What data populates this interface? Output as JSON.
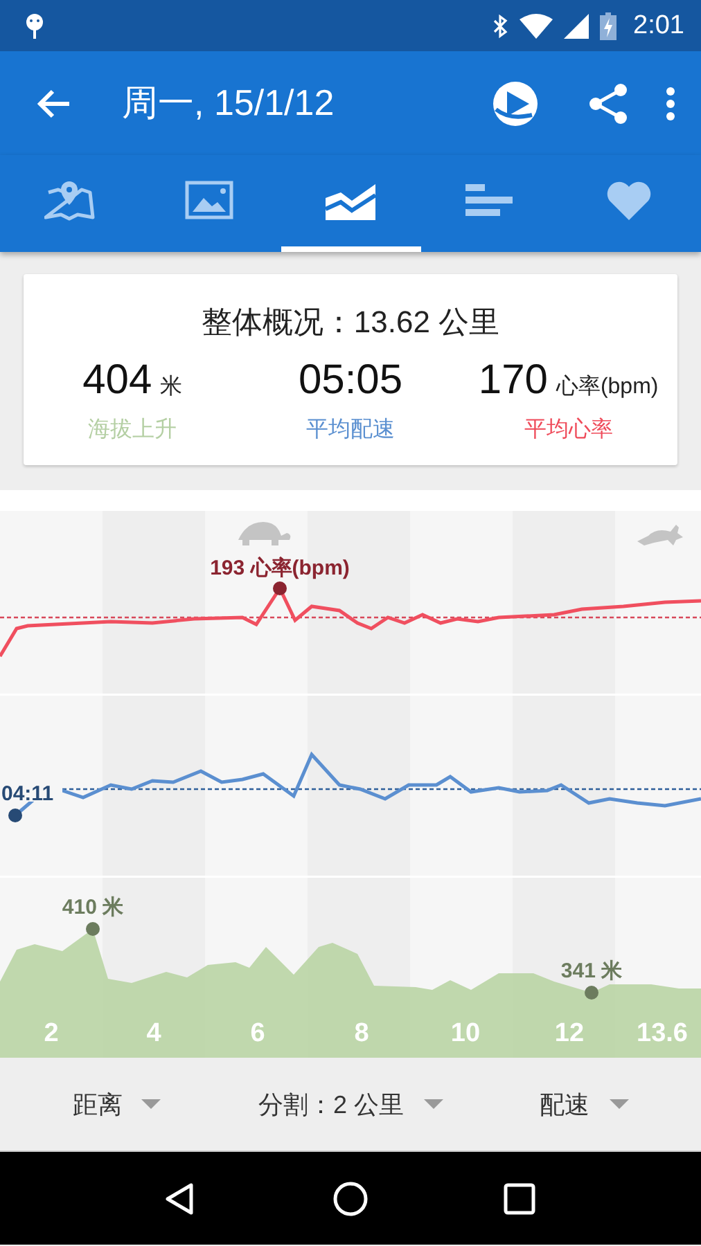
{
  "status_bar": {
    "time": "2:01"
  },
  "app_bar": {
    "title": "周一, 15/1/12"
  },
  "tabs": [
    {
      "kind": "map",
      "selected": false
    },
    {
      "kind": "photo",
      "selected": false
    },
    {
      "kind": "chart",
      "selected": true
    },
    {
      "kind": "bars",
      "selected": false
    },
    {
      "kind": "heart",
      "selected": false
    }
  ],
  "summary": {
    "title": "整体概况：13.62 公里",
    "stats": [
      {
        "value": "404",
        "unit": "米",
        "label": "海拔上升",
        "color": "#b4cfa3"
      },
      {
        "value": "05:05",
        "label": "平均配速",
        "color": "#5a8fd0"
      },
      {
        "value": "170",
        "unit": "心率(bpm)",
        "label": "平均心率",
        "color": "#ef4b5a"
      }
    ]
  },
  "chart": {
    "panels": [
      {
        "kind": "heart_rate",
        "annotations": [
          "193 心率(bpm)"
        ]
      },
      {
        "kind": "pace",
        "annotations": [
          "04:11"
        ]
      },
      {
        "kind": "elevation",
        "annotations": [
          "410 米",
          "341 米"
        ]
      }
    ],
    "x_labels": [
      "2",
      "4",
      "6",
      "8",
      "10",
      "12",
      "13.6"
    ]
  },
  "selectors": [
    {
      "label": "距离"
    },
    {
      "label": "分割：2 公里"
    },
    {
      "label": "配速"
    }
  ]
}
